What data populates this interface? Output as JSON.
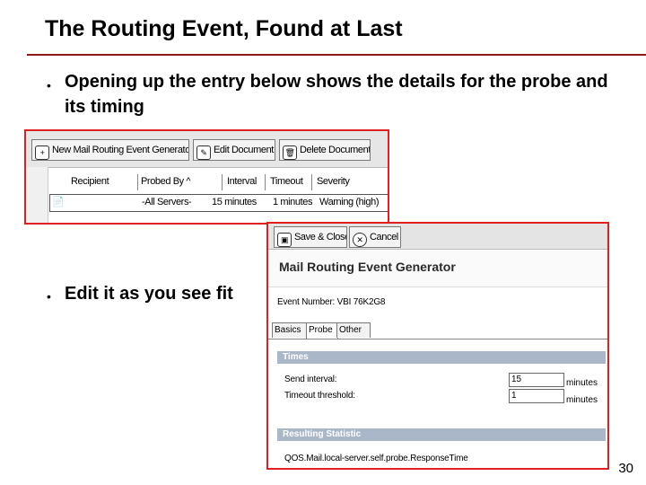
{
  "slide": {
    "title": "The Routing Event, Found at Last",
    "bullets": [
      "Opening up the entry below shows the details for the probe and its timing",
      "Edit it as you see fit"
    ],
    "page_number": "30",
    "accent_color": "#8b1a1a"
  },
  "view_screenshot": {
    "toolbar": [
      {
        "label": "New Mail Routing Event Generator",
        "icon": "new-doc-icon"
      },
      {
        "label": "Edit Document",
        "icon": "pencil-icon"
      },
      {
        "label": "Delete Document",
        "icon": "trash-icon"
      }
    ],
    "columns": [
      "Recipient",
      "Probed By ^",
      "Interval",
      "Timeout",
      "Severity"
    ],
    "row": {
      "recipient": "",
      "probed_by": "-All Servers-",
      "interval": "15 minutes",
      "timeout": "1 minutes",
      "severity": "Warning (high)"
    }
  },
  "form_screenshot": {
    "toolbar": [
      {
        "label": "Save & Close",
        "icon": "save-icon"
      },
      {
        "label": "Cancel",
        "icon": "cancel-icon"
      }
    ],
    "form_title": "Mail Routing Event Generator",
    "event_number": "Event Number: VBI 76K2G8",
    "tabs": [
      "Basics",
      "Probe",
      "Other"
    ],
    "active_tab": "Probe",
    "sections": {
      "times": {
        "title": "Times",
        "send_interval_label": "Send interval:",
        "send_interval_value": "15",
        "timeout_label": "Timeout threshold:",
        "timeout_value": "1",
        "unit": "minutes"
      },
      "stat": {
        "title": "Resulting Statistic",
        "value": "QOS.Mail.local-server.self.probe.ResponseTime"
      }
    }
  }
}
